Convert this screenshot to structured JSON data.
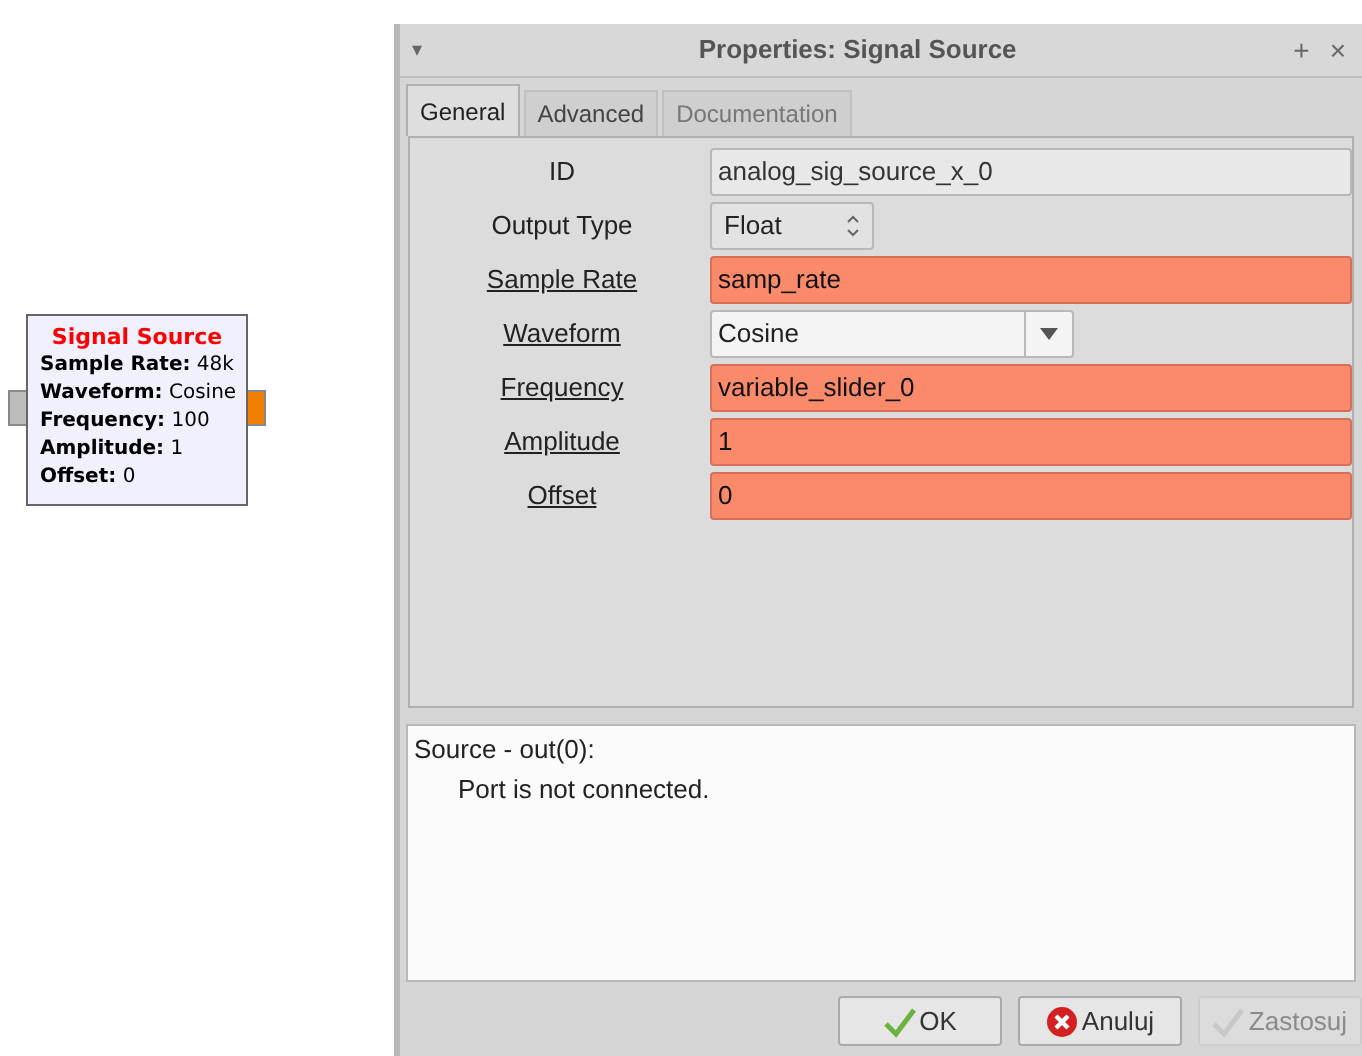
{
  "block": {
    "title": "Signal Source",
    "params": [
      {
        "label": "Sample Rate:",
        "value": "48k"
      },
      {
        "label": "Waveform:",
        "value": "Cosine"
      },
      {
        "label": "Frequency:",
        "value": "100"
      },
      {
        "label": "Amplitude:",
        "value": "1"
      },
      {
        "label": "Offset:",
        "value": "0"
      }
    ]
  },
  "window": {
    "title": "Properties: Signal Source",
    "menu_glyph": "▾",
    "pin_glyph": "+",
    "close_glyph": "×"
  },
  "tabs": [
    {
      "label": "General",
      "selected": true
    },
    {
      "label": "Advanced",
      "selected": false
    },
    {
      "label": "Documentation",
      "selected": false
    }
  ],
  "fields": [
    {
      "label": "ID",
      "kind": "text",
      "value": "analog_sig_source_x_0",
      "underlined": false,
      "highlighted": false
    },
    {
      "label": "Output Type",
      "kind": "spin",
      "value": "Float",
      "underlined": false
    },
    {
      "label": "Sample Rate",
      "kind": "text",
      "value": "samp_rate",
      "underlined": true,
      "highlighted": true
    },
    {
      "label": "Waveform",
      "kind": "combo",
      "value": "Cosine",
      "underlined": true
    },
    {
      "label": "Frequency",
      "kind": "text",
      "value": "variable_slider_0",
      "underlined": true,
      "highlighted": true
    },
    {
      "label": "Amplitude",
      "kind": "text",
      "value": "1",
      "underlined": true,
      "highlighted": true
    },
    {
      "label": "Offset",
      "kind": "text",
      "value": "0",
      "underlined": true,
      "highlighted": true
    }
  ],
  "messages": {
    "heading": "Source - out(0):",
    "text": "Port is not connected."
  },
  "buttons": [
    {
      "label": "OK",
      "kind": "ok",
      "disabled": false
    },
    {
      "label": "Anuluj",
      "kind": "cancel",
      "disabled": false
    },
    {
      "label": "Zastosuj",
      "kind": "apply",
      "disabled": true
    }
  ]
}
